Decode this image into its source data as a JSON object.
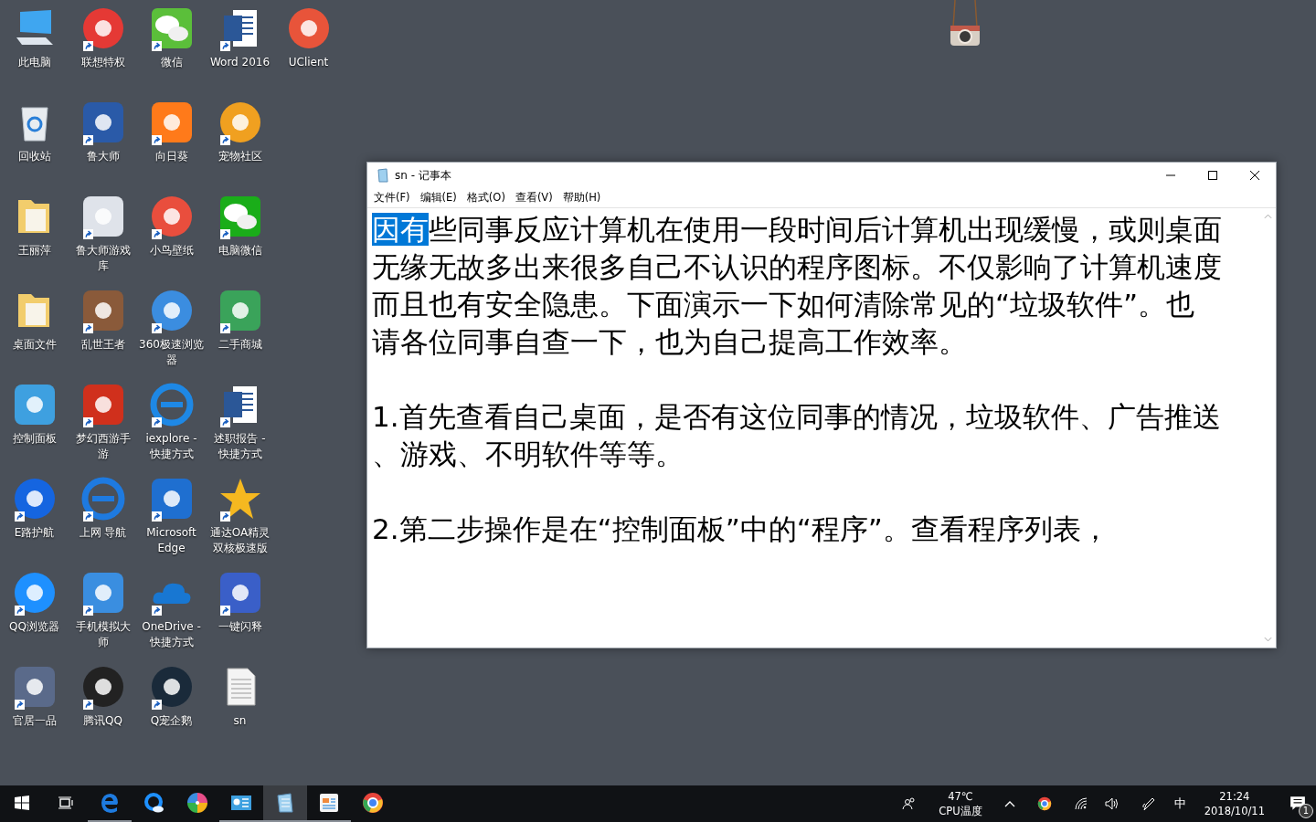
{
  "desktop_icons": [
    [
      {
        "label": "此电脑",
        "kind": "computer",
        "shortcut": false
      },
      {
        "label": "联想特权",
        "kind": "circle",
        "color": "#e53935",
        "shortcut": true
      },
      {
        "label": "微信",
        "kind": "chat",
        "color": "#5bbf3a",
        "shortcut": true
      },
      {
        "label": "Word 2016",
        "kind": "word",
        "shortcut": true
      },
      {
        "label": "UClient",
        "kind": "circle",
        "color": "#e8543a",
        "shortcut": false
      }
    ],
    [
      {
        "label": "回收站",
        "kind": "recycle",
        "shortcut": false
      },
      {
        "label": "鲁大师",
        "kind": "tile",
        "color": "#2a5aa8",
        "shortcut": true
      },
      {
        "label": "向日葵",
        "kind": "tile",
        "color": "#ff7a1a",
        "shortcut": true
      },
      {
        "label": "宠物社区",
        "kind": "circle",
        "color": "#f0a020",
        "shortcut": true
      }
    ],
    [
      {
        "label": "王丽萍",
        "kind": "folder",
        "shortcut": false
      },
      {
        "label": "鲁大师游戏库",
        "kind": "tile",
        "color": "#dfe3ea",
        "shortcut": true
      },
      {
        "label": "小鸟壁纸",
        "kind": "circle",
        "color": "#e94e3d",
        "shortcut": true
      },
      {
        "label": "电脑微信",
        "kind": "chat",
        "color": "#1aad19",
        "shortcut": true
      }
    ],
    [
      {
        "label": "桌面文件",
        "kind": "folder",
        "shortcut": false
      },
      {
        "label": "乱世王者",
        "kind": "tile",
        "color": "#8a5a3a",
        "shortcut": true
      },
      {
        "label": "360极速浏览器",
        "kind": "circle",
        "color": "#3b8de0",
        "shortcut": true
      },
      {
        "label": "二手商城",
        "kind": "tile",
        "color": "#3aa35a",
        "shortcut": true
      }
    ],
    [
      {
        "label": "控制面板",
        "kind": "tile",
        "color": "#3ea0e0",
        "shortcut": false
      },
      {
        "label": "梦幻西游手游",
        "kind": "tile",
        "color": "#d0301c",
        "shortcut": true
      },
      {
        "label": "iexplore - 快捷方式",
        "kind": "browser",
        "color": "#1e88e5",
        "shortcut": true
      },
      {
        "label": "述职报告 - 快捷方式",
        "kind": "word",
        "shortcut": true
      }
    ],
    [
      {
        "label": "E路护航",
        "kind": "circle",
        "color": "#1565e0",
        "shortcut": true
      },
      {
        "label": "上网 导航",
        "kind": "browser",
        "color": "#1e7ae0",
        "shortcut": true
      },
      {
        "label": "Microsoft Edge",
        "kind": "tile",
        "color": "#1f6fd0",
        "shortcut": true
      },
      {
        "label": "通达OA精灵双核极速版",
        "kind": "star",
        "color": "#f5b820",
        "shortcut": true
      }
    ],
    [
      {
        "label": "QQ浏览器",
        "kind": "circle",
        "color": "#1e90ff",
        "shortcut": true
      },
      {
        "label": "手机模拟大师",
        "kind": "tile",
        "color": "#3a8ee0",
        "shortcut": true
      },
      {
        "label": "OneDrive - 快捷方式",
        "kind": "cloud",
        "color": "#1877d2",
        "shortcut": true
      },
      {
        "label": "一键闪释",
        "kind": "tile",
        "color": "#3a5fc8",
        "shortcut": true
      }
    ],
    [
      {
        "label": "官居一品",
        "kind": "tile",
        "color": "#5a6a8a",
        "shortcut": true
      },
      {
        "label": "腾讯QQ",
        "kind": "circle",
        "color": "#222222",
        "shortcut": true
      },
      {
        "label": "Q宠企鹅",
        "kind": "circle",
        "color": "#1a2a3a",
        "shortcut": true
      },
      {
        "label": "sn",
        "kind": "text",
        "shortcut": false
      }
    ]
  ],
  "notepad": {
    "title": "sn - 记事本",
    "menu": [
      "文件(F)",
      "编辑(E)",
      "格式(O)",
      "查看(V)",
      "帮助(H)"
    ],
    "selection": "因有",
    "paragraphs": [
      [
        "些同事反应计算机在使用一段时间后计算机出现缓慢，或则桌面",
        "无缘无故多出来很多自己不认识的程序图标。不仅影响了计算机速度",
        "而且也有安全隐患。下面演示一下如何清除常见的“垃圾软件”。也",
        "请各位同事自查一下，也为自己提高工作效率。"
      ],
      [
        "1.首先查看自己桌面，是否有这位同事的情况，垃圾软件、广告推送",
        "、游戏、不明软件等等。"
      ],
      [
        "2.第二步操作是在“控制面板”中的“程序”。查看程序列表，"
      ]
    ]
  },
  "taskbar": {
    "apps": [
      {
        "kind": "edge",
        "running": true,
        "active": false
      },
      {
        "kind": "qqbrowser",
        "running": false,
        "active": false
      },
      {
        "kind": "pinwheel",
        "running": false,
        "active": false
      },
      {
        "kind": "panel",
        "running": true,
        "active": false
      },
      {
        "kind": "notepad",
        "running": true,
        "active": true
      },
      {
        "kind": "news",
        "running": true,
        "active": false
      },
      {
        "kind": "chrome",
        "running": false,
        "active": false
      }
    ],
    "temperature": "47℃",
    "temperature_label": "CPU温度",
    "input_method": "中",
    "time": "21:24",
    "date": "2018/10/11",
    "notifications": "1"
  }
}
